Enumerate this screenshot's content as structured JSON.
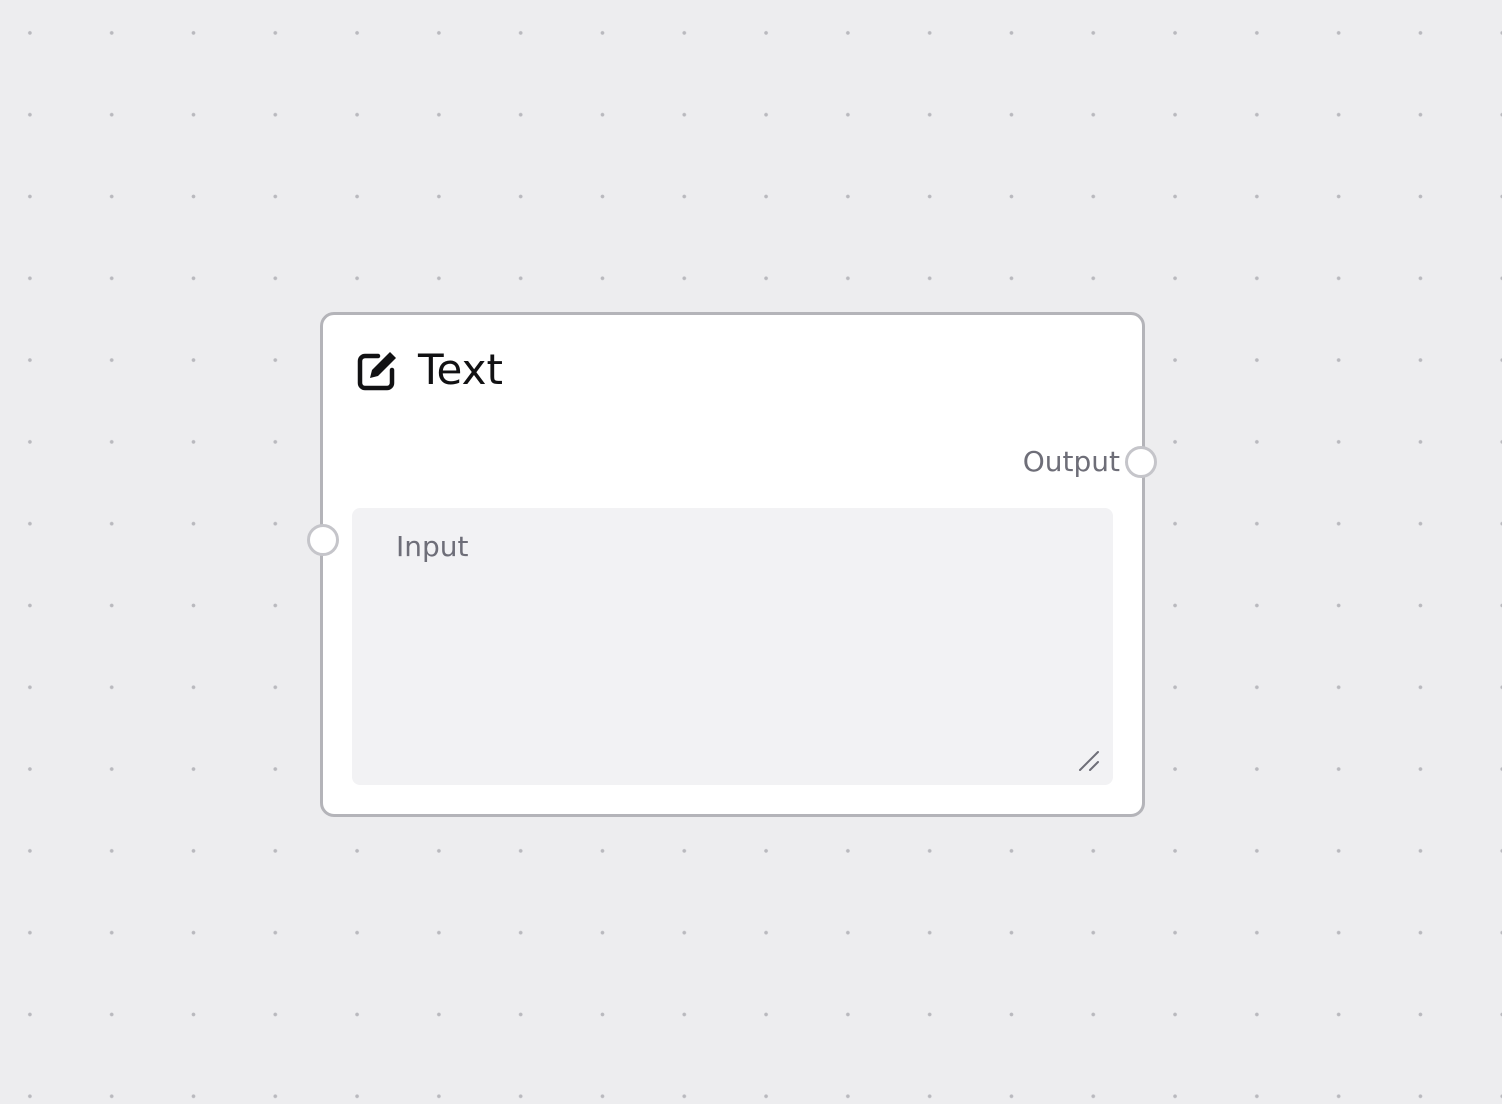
{
  "node": {
    "title": "Text",
    "icon": "edit-icon",
    "output_label": "Output",
    "input_placeholder": "Input"
  },
  "colors": {
    "canvas_background": "#ededef",
    "grid_dot": "#b9b9be",
    "node_border": "#b4b4b9",
    "textarea_background": "#f2f2f4",
    "muted_text": "#6e6e78",
    "title_text": "#111113"
  }
}
